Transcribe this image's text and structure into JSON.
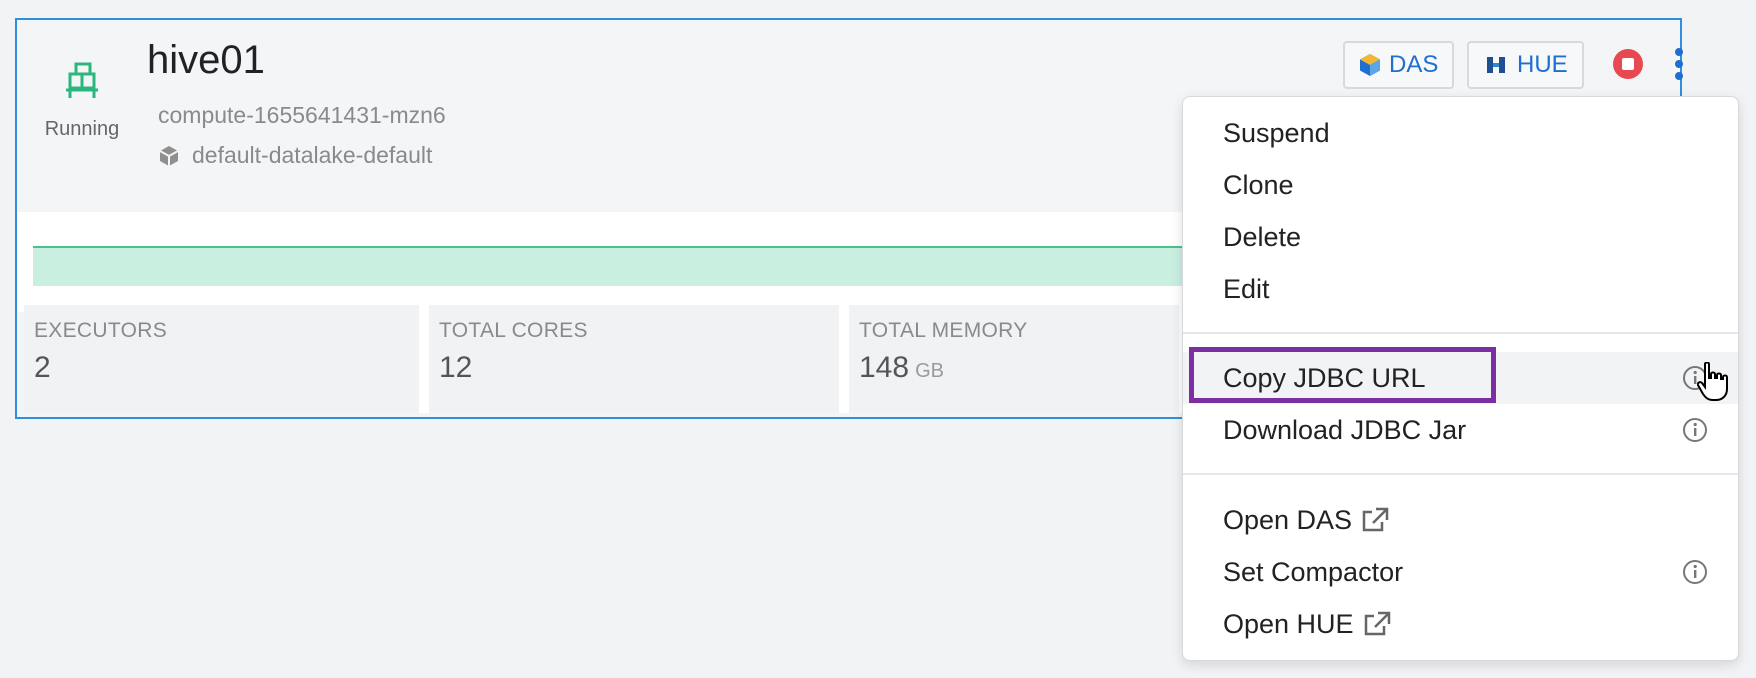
{
  "card": {
    "title": "hive01",
    "status": "Running",
    "compute_id": "compute-1655641431-mzn6",
    "datalake": "default-datalake-default",
    "buttons": {
      "das": "DAS",
      "hue": "HUE"
    },
    "stats": [
      {
        "label": "EXECUTORS",
        "value": "2",
        "unit": ""
      },
      {
        "label": "TOTAL CORES",
        "value": "12",
        "unit": ""
      },
      {
        "label": "TOTAL MEMORY",
        "value": "148",
        "unit": "GB"
      }
    ]
  },
  "menu": {
    "group1": [
      "Suspend",
      "Clone",
      "Delete",
      "Edit"
    ],
    "group2": [
      "Copy JDBC URL",
      "Download JDBC Jar"
    ],
    "group3": [
      "Open DAS",
      "Set Compactor",
      "Open HUE"
    ]
  },
  "colors": {
    "accent_blue": "#2f8fdc",
    "running_green": "#2bb67d",
    "stop_red": "#e8484f",
    "highlight_purple": "#7b2fa3",
    "progress_fill": "#c9efe1"
  },
  "icons": {
    "status": "warehouse-icon",
    "datalake": "cube-icon",
    "das": "das-logo-icon",
    "hue": "hue-logo-icon",
    "stop": "stop-icon",
    "more": "kebab-menu-icon",
    "info": "info-icon",
    "external": "external-link-icon",
    "cursor": "hand-pointer-icon"
  }
}
